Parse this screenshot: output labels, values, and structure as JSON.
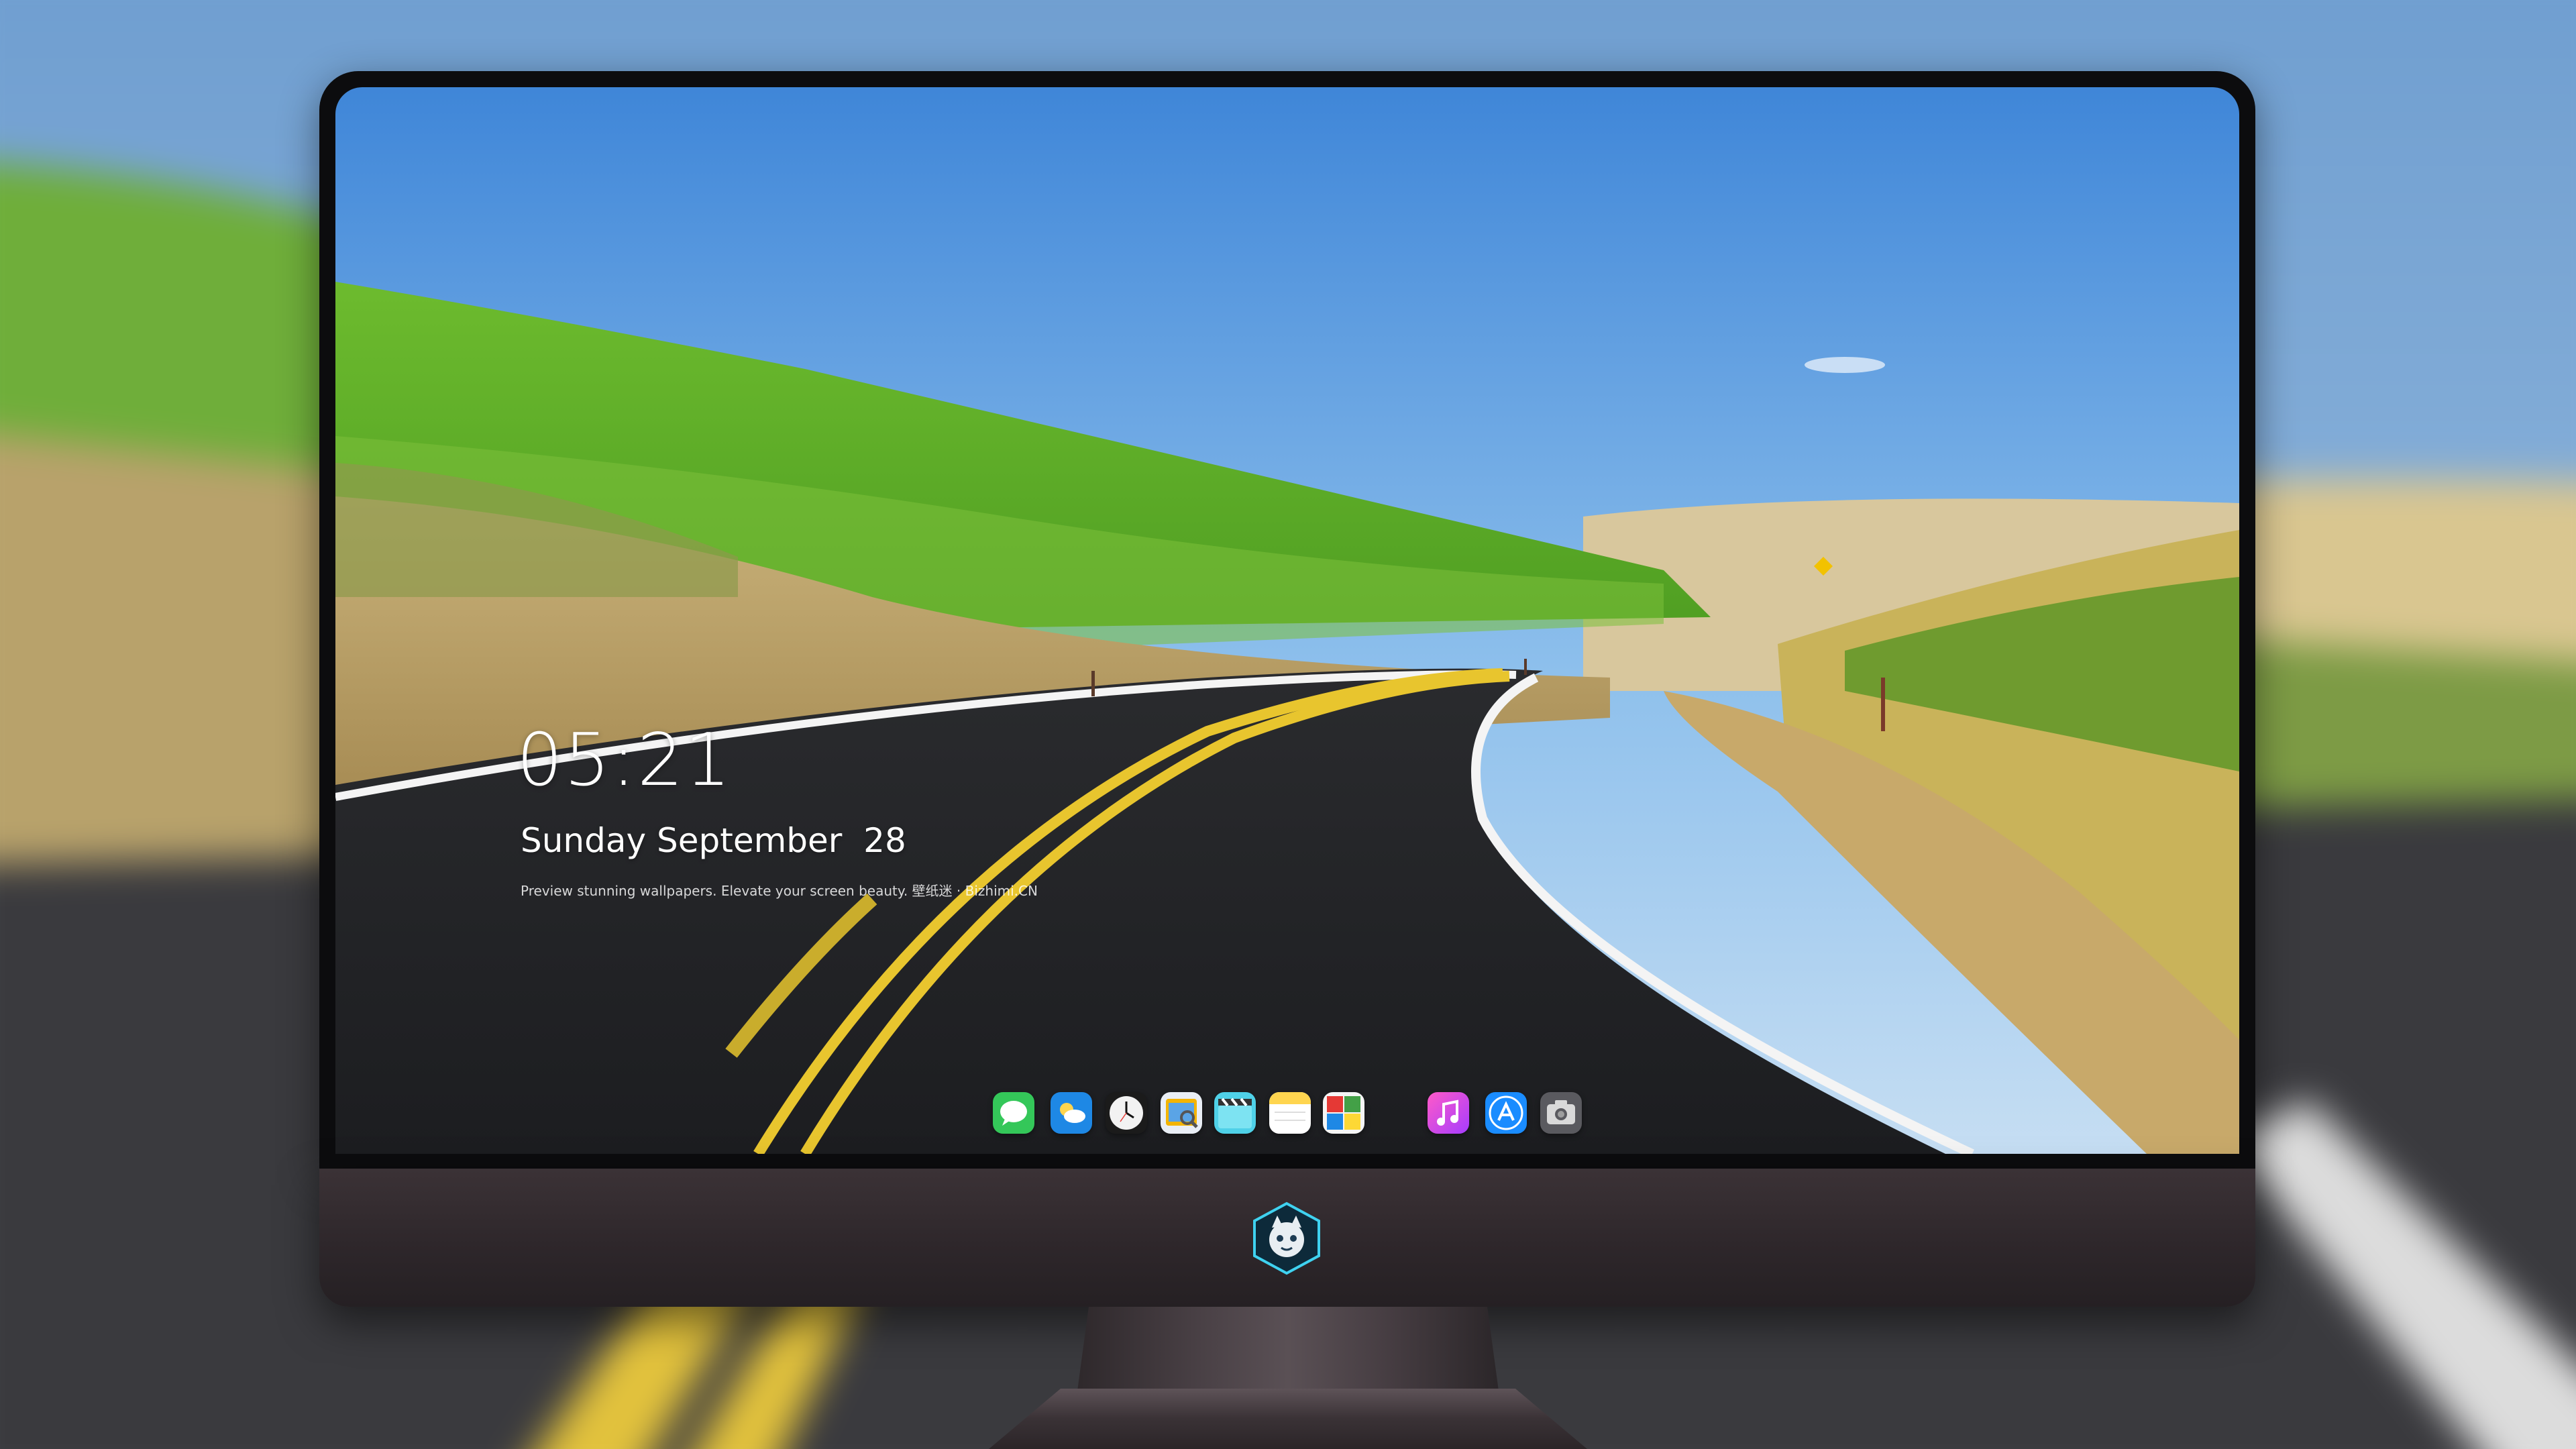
{
  "lock_screen": {
    "time": "05:21",
    "date": "Sunday September  28",
    "tagline": "Preview stunning wallpapers. Elevate your screen beauty. 壁纸迷 · Bizhimi.CN"
  },
  "dock": {
    "apps": [
      {
        "name": "messages-icon",
        "color": "#35c759"
      },
      {
        "name": "weather-icon",
        "color": "#1e88e5"
      },
      {
        "name": "clock-icon",
        "color": "#f2f2f2"
      },
      {
        "name": "preview-icon",
        "color": "#f3b400"
      },
      {
        "name": "clips-icon",
        "color": "#4fd1e8"
      },
      {
        "name": "notes-icon",
        "color": "#ffd54f"
      },
      {
        "name": "photo-booth-icon",
        "color": "#e53935"
      },
      {
        "name": "itunes-icon",
        "color": "#e040fb"
      },
      {
        "name": "app-store-icon",
        "color": "#1a8cff"
      },
      {
        "name": "screenshot-icon",
        "color": "#5a5a5f"
      }
    ]
  },
  "monitor": {
    "chin_logo": "mascot-logo-icon"
  }
}
